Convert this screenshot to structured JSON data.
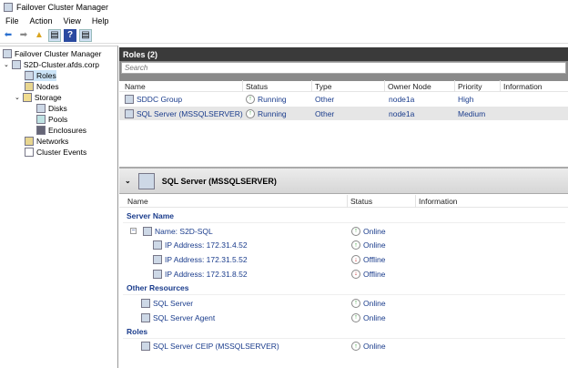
{
  "window": {
    "title": "Failover Cluster Manager"
  },
  "menu": [
    "File",
    "Action",
    "View",
    "Help"
  ],
  "tree": {
    "root": "Failover Cluster Manager",
    "cluster": "S2D-Cluster.afds.corp",
    "items": [
      "Roles",
      "Nodes",
      "Storage",
      "Disks",
      "Pools",
      "Enclosures",
      "Networks",
      "Cluster Events"
    ]
  },
  "roles": {
    "title": "Roles (2)",
    "search_placeholder": "Search",
    "columns": [
      "Name",
      "Status",
      "Type",
      "Owner Node",
      "Priority",
      "Information"
    ],
    "rows": [
      {
        "name": "SDDC Group",
        "status": "Running",
        "type": "Other",
        "owner": "node1a",
        "priority": "High",
        "info": ""
      },
      {
        "name": "SQL Server (MSSQLSERVER)",
        "status": "Running",
        "type": "Other",
        "owner": "node1a",
        "priority": "Medium",
        "info": ""
      }
    ]
  },
  "details": {
    "title": "SQL Server (MSSQLSERVER)",
    "columns": [
      "Name",
      "Status",
      "Information"
    ],
    "sections": [
      {
        "label": "Server Name",
        "items": [
          {
            "name": "Name: S2D-SQL",
            "status": "Online"
          },
          {
            "name": "IP Address: 172.31.4.52",
            "status": "Online"
          },
          {
            "name": "IP Address: 172.31.5.52",
            "status": "Offline"
          },
          {
            "name": "IP Address: 172.31.8.52",
            "status": "Offline"
          }
        ]
      },
      {
        "label": "Other Resources",
        "items": [
          {
            "name": "SQL Server",
            "status": "Online"
          },
          {
            "name": "SQL Server Agent",
            "status": "Online"
          }
        ]
      },
      {
        "label": "Roles",
        "items": [
          {
            "name": "SQL Server CEIP (MSSQLSERVER)",
            "status": "Online"
          }
        ]
      }
    ]
  },
  "colors": {
    "online": "#2a9a2a",
    "offline": "#c82020",
    "link_text": "#1a3c8c",
    "header_bar": "#3a3a3a"
  }
}
